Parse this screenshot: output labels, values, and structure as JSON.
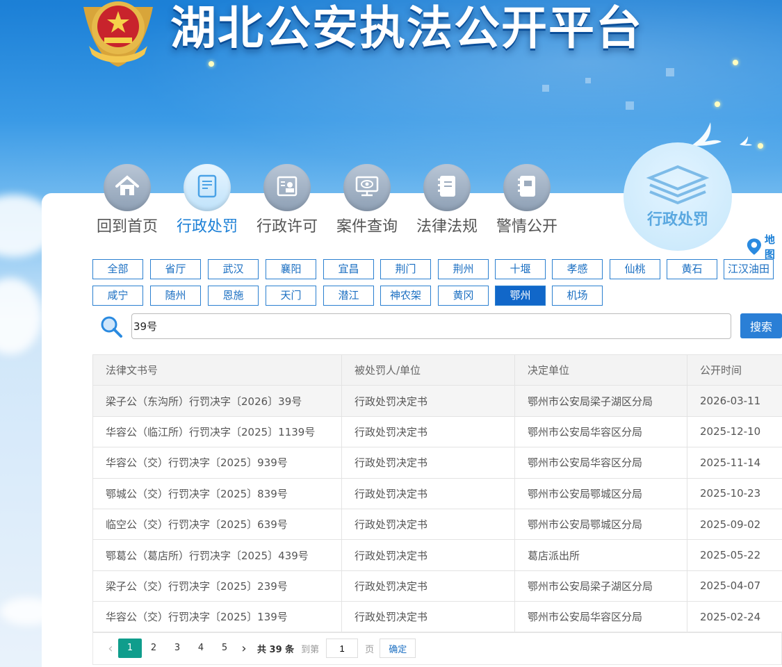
{
  "header": {
    "site_title": "湖北公安执法公开平台"
  },
  "nav": {
    "items": [
      {
        "label": "回到首页",
        "icon": "home-icon"
      },
      {
        "label": "行政处罚",
        "icon": "document-icon"
      },
      {
        "label": "行政许可",
        "icon": "permit-icon"
      },
      {
        "label": "案件查询",
        "icon": "monitor-eye-icon"
      },
      {
        "label": "法律法规",
        "icon": "book-icon"
      },
      {
        "label": "警情公开",
        "icon": "notebook-icon"
      }
    ],
    "active_index": 1,
    "badge_label": "行政处罚",
    "map_label": "地图"
  },
  "regions": {
    "items": [
      "全部",
      "省厅",
      "武汉",
      "襄阳",
      "宜昌",
      "荆门",
      "荆州",
      "十堰",
      "孝感",
      "仙桃",
      "黄石",
      "江汉油田",
      "咸宁",
      "随州",
      "恩施",
      "天门",
      "潜江",
      "神农架",
      "黄冈",
      "鄂州",
      "机场"
    ],
    "active": "鄂州"
  },
  "search": {
    "value": "39号",
    "button_label": "搜索"
  },
  "table": {
    "headers": [
      "法律文书号",
      "被处罚人/单位",
      "决定单位",
      "公开时间"
    ],
    "rows": [
      [
        "梁子公（东沟所）行罚决字〔2026〕39号",
        "行政处罚决定书",
        "鄂州市公安局梁子湖区分局",
        "2026-03-11"
      ],
      [
        "华容公（临江所）行罚决字〔2025〕1139号",
        "行政处罚决定书",
        "鄂州市公安局华容区分局",
        "2025-12-10"
      ],
      [
        "华容公（交）行罚决字〔2025〕939号",
        "行政处罚决定书",
        "鄂州市公安局华容区分局",
        "2025-11-14"
      ],
      [
        "鄂城公（交）行罚决字〔2025〕839号",
        "行政处罚决定书",
        "鄂州市公安局鄂城区分局",
        "2025-10-23"
      ],
      [
        "临空公（交）行罚决字〔2025〕639号",
        "行政处罚决定书",
        "鄂州市公安局鄂城区分局",
        "2025-09-02"
      ],
      [
        "鄂葛公（葛店所）行罚决字〔2025〕439号",
        "行政处罚决定书",
        "葛店派出所",
        "2025-05-22"
      ],
      [
        "梁子公（交）行罚决字〔2025〕239号",
        "行政处罚决定书",
        "鄂州市公安局梁子湖区分局",
        "2025-04-07"
      ],
      [
        "华容公（交）行罚决字〔2025〕139号",
        "行政处罚决定书",
        "鄂州市公安局华容区分局",
        "2025-02-24"
      ]
    ]
  },
  "pager": {
    "pages": [
      "1",
      "2",
      "3",
      "4",
      "5"
    ],
    "active_page": "1",
    "total": "共 39 条",
    "goto_label": "到第",
    "page_input": "1",
    "page_unit": "页",
    "confirm_label": "确定"
  },
  "colors": {
    "primary": "#1b7fd6",
    "active_region": "#1167c9",
    "active_page": "#0f9d8c"
  }
}
